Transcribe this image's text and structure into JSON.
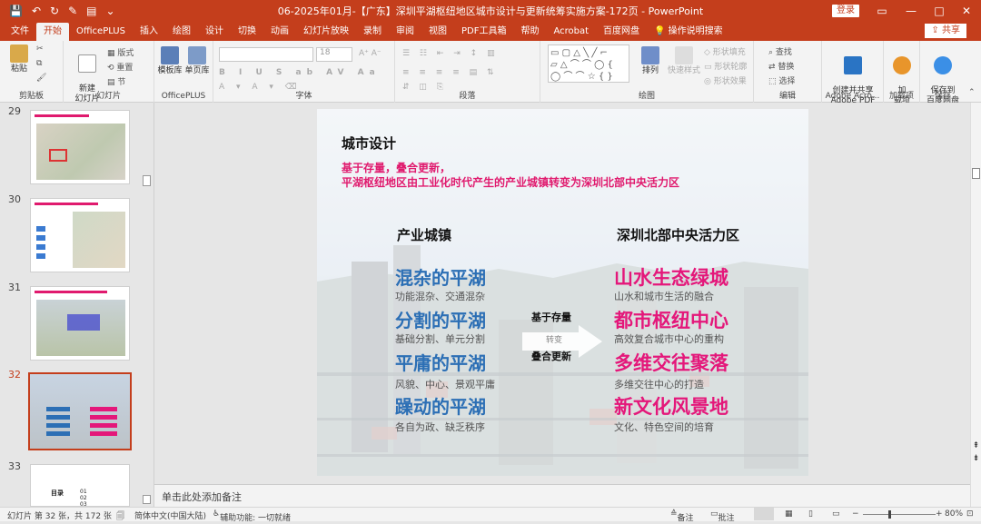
{
  "titlebar": {
    "title": "06-2025年01月-【广东】深圳平湖枢纽地区城市设计与更新统筹实施方案-172页 - PowerPoint",
    "login": "登录",
    "win_min": "—",
    "win_restore": "▭",
    "win_max": "□",
    "win_close": "✕"
  },
  "tabs": [
    "文件",
    "开始",
    "OfficePLUS",
    "插入",
    "绘图",
    "设计",
    "切换",
    "动画",
    "幻灯片放映",
    "录制",
    "审阅",
    "视图",
    "PDF工具箱",
    "帮助",
    "Acrobat",
    "百度网盘",
    "操作说明搜索"
  ],
  "share_label": "共享",
  "ribbon": {
    "clipboard": {
      "paste": "粘贴",
      "label": "剪贴板"
    },
    "slides": {
      "new_slide": "新建\n幻灯片",
      "layout": "版式",
      "reset": "重置",
      "section": "节",
      "label": "幻灯片"
    },
    "officeplus": {
      "templates": "模板库",
      "single": "单页库",
      "label": "OfficePLUS"
    },
    "font": {
      "label": "字体",
      "size": "18"
    },
    "paragraph": {
      "label": "段落"
    },
    "drawing": {
      "arrange": "排列",
      "quick_styles": "快速样式",
      "fill": "形状填充",
      "outline": "形状轮廓",
      "effects": "形状效果",
      "label": "绘图"
    },
    "editing": {
      "find": "查找",
      "replace": "替换",
      "select": "选择",
      "label": "编辑"
    },
    "adobe": {
      "create": "创建并共享\nAdobe PDF",
      "label": "Adobe Acro..."
    },
    "addins": {
      "addin": "加\n载项",
      "label": "加载项"
    },
    "save": {
      "save_baidu": "保存到\n百度网盘",
      "label": "保存"
    }
  },
  "thumbnails": [
    {
      "num": "29",
      "selected": false
    },
    {
      "num": "30",
      "selected": false
    },
    {
      "num": "31",
      "selected": false
    },
    {
      "num": "32",
      "selected": true
    },
    {
      "num": "33",
      "selected": false
    }
  ],
  "thumb33": {
    "text1": "01",
    "text2": "02",
    "text3": "03",
    "label": "目录"
  },
  "slide": {
    "title": "城市设计",
    "subtitle_line1": "基于存量，叠合更新，",
    "subtitle_line2": "平湖枢纽地区由工业化时代产生的产业城镇转变为深圳北部中央活力区",
    "left_heading": "产业城镇",
    "right_heading": "深圳北部中央活力区",
    "left_items": [
      {
        "title": "混杂的平湖",
        "desc": "功能混杂、交通混杂"
      },
      {
        "title": "分割的平湖",
        "desc": "基础分割、单元分割"
      },
      {
        "title": "平庸的平湖",
        "desc": "风貌、中心、景观平庸"
      },
      {
        "title": "躁动的平湖",
        "desc": "各自为政、缺乏秩序"
      }
    ],
    "right_items": [
      {
        "title": "山水生态绿城",
        "desc": "山水和城市生活的融合"
      },
      {
        "title": "都市枢纽中心",
        "desc": "高效复合城市中心的重构"
      },
      {
        "title": "多维交往聚落",
        "desc": "多维交往中心的打造"
      },
      {
        "title": "新文化风景地",
        "desc": "文化、特色空间的培育"
      }
    ],
    "arrow_top": "基于存量",
    "arrow_mid": "转变",
    "arrow_bottom": "叠合更新"
  },
  "notes_placeholder": "单击此处添加备注",
  "status": {
    "slide_info": "幻灯片 第 32 张，共 172 张",
    "language": "简体中文(中国大陆)",
    "accessibility": "辅助功能: 一切就绪",
    "notes": "备注",
    "comments": "批注",
    "zoom": "80%"
  },
  "colors": {
    "accent": "#c43e1c",
    "slide_blue": "#2c6fb5",
    "slide_pink": "#e4177a"
  }
}
